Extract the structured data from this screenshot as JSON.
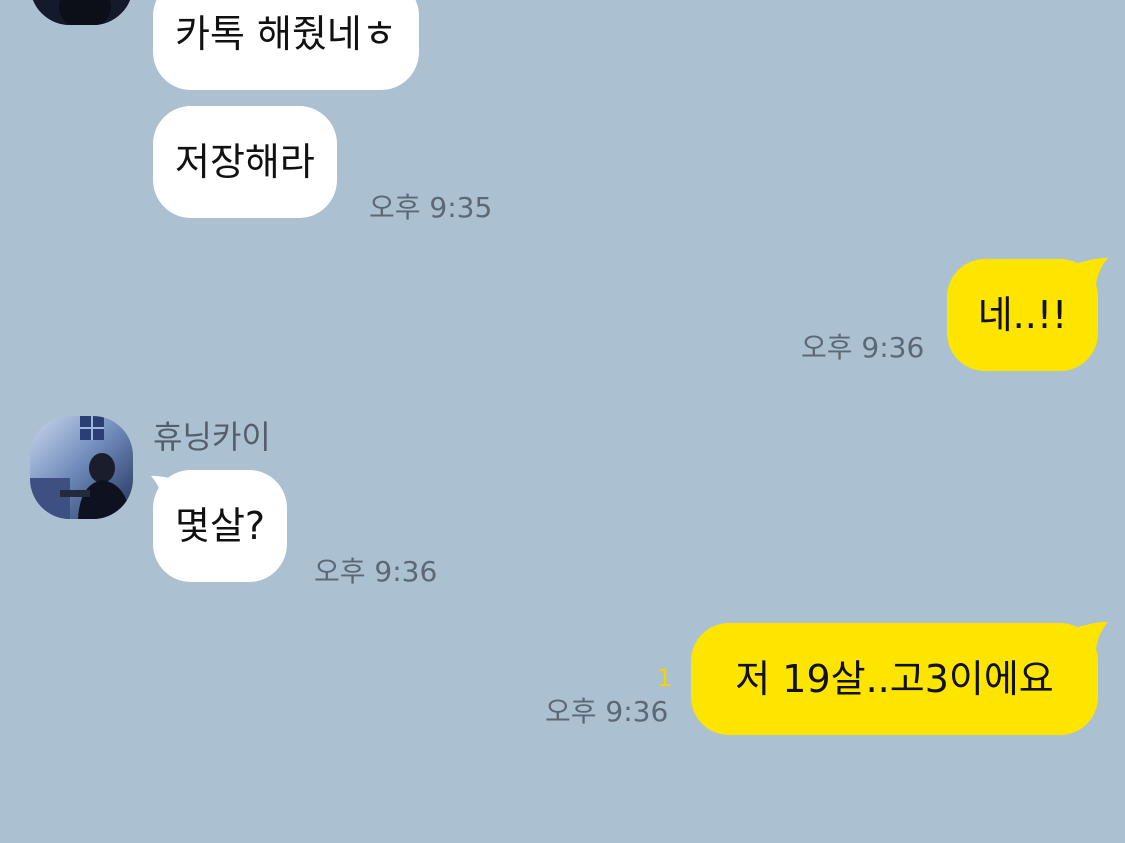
{
  "colors": {
    "background": "#abc1d1",
    "incoming_bubble": "#ffffff",
    "outgoing_bubble": "#fee500",
    "timestamp": "#5d6875",
    "unread_count": "#f5d300"
  },
  "messages": [
    {
      "direction": "incoming",
      "text": "카톡 해줬네ㅎ"
    },
    {
      "direction": "incoming",
      "text": "저장해라",
      "time": "오후 9:35"
    },
    {
      "direction": "outgoing",
      "text": "네..!!",
      "time": "오후 9:36"
    },
    {
      "direction": "incoming",
      "sender": "휴닝카이",
      "avatar_icon": "profile-photo",
      "text": "몇살?",
      "time": "오후 9:36"
    },
    {
      "direction": "outgoing",
      "text": "저 19살..고3이에요",
      "time": "오후 9:36",
      "unread_count": "1"
    }
  ]
}
